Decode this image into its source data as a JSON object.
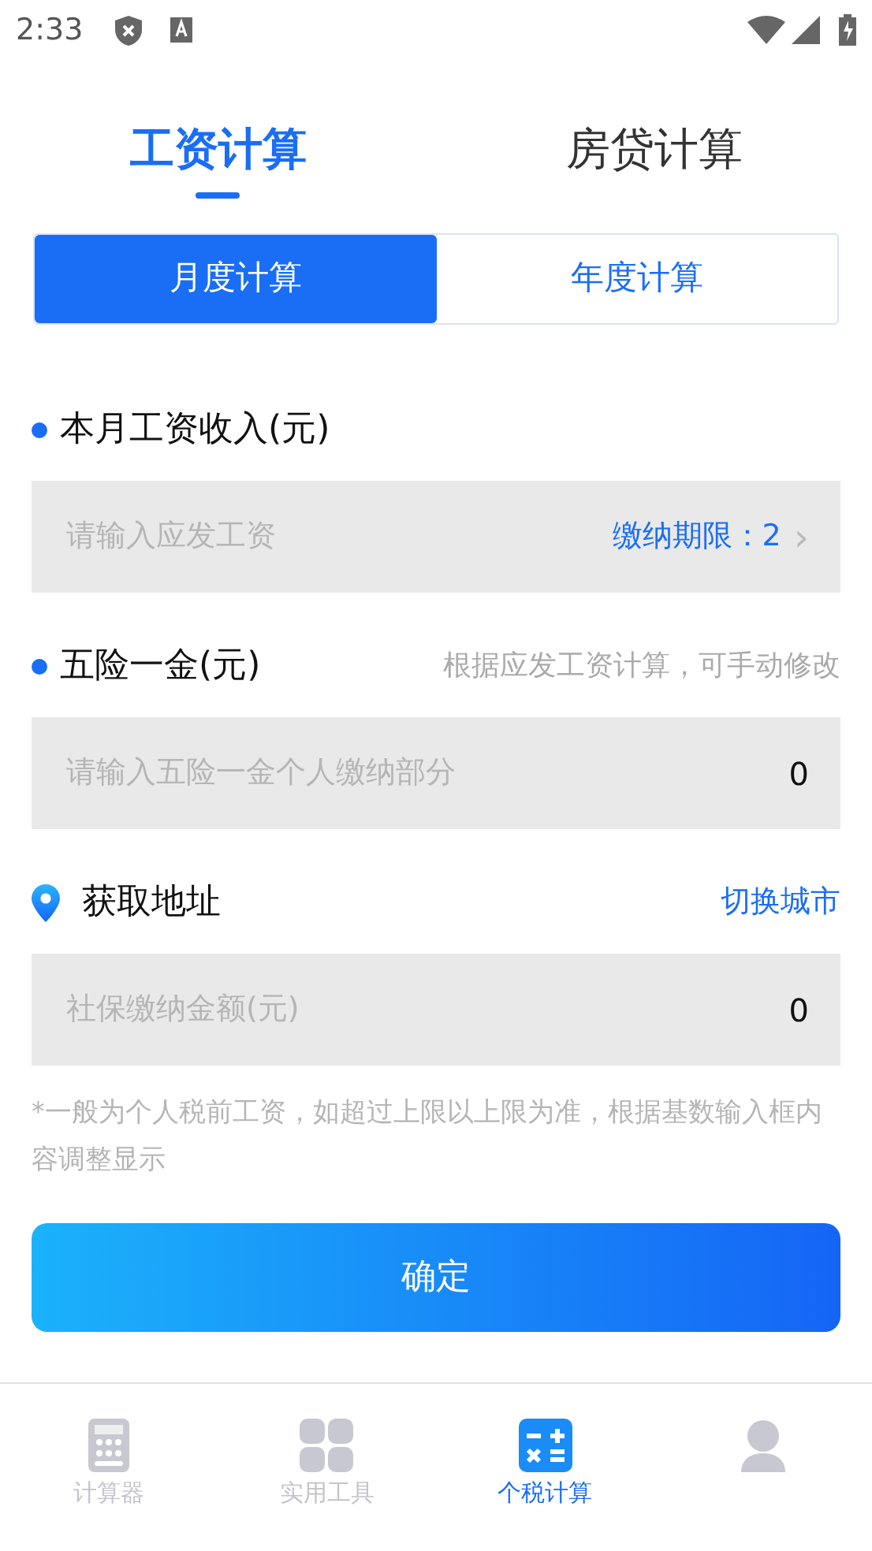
{
  "status_bar": {
    "time": "2:33"
  },
  "top_tabs": [
    {
      "label": "工资计算",
      "selected": true
    },
    {
      "label": "房贷计算",
      "selected": false
    }
  ],
  "period_tabs": [
    {
      "label": "月度计算",
      "selected": true
    },
    {
      "label": "年度计算",
      "selected": false
    }
  ],
  "sections": [
    {
      "kind": "dot",
      "label": "本月工资收入(元)",
      "field": {
        "placeholder": "请输入应发工资",
        "link": "缴纳期限：2",
        "chevron": "›"
      }
    },
    {
      "kind": "dot",
      "label": "五险一金(元)",
      "hint": "根据应发工资计算，可手动修改",
      "field": {
        "placeholder": "请输入五险一金个人缴纳部分",
        "value": "0"
      }
    },
    {
      "kind": "location",
      "label": "获取地址",
      "action": "切换城市",
      "field": {
        "placeholder": "社保缴纳金额(元)",
        "value": "0"
      }
    }
  ],
  "note": "*一般为个人税前工资，如超过上限以上限为准，根据基数输入框内容调整显示",
  "confirm_button": "确定",
  "bottom_nav": [
    {
      "kind": "calculator",
      "label": "计算器",
      "selected": false
    },
    {
      "kind": "grid",
      "label": "实用工具",
      "selected": false
    },
    {
      "kind": "tax",
      "label": "个税计算",
      "selected": true
    },
    {
      "kind": "person",
      "selected": false
    }
  ]
}
